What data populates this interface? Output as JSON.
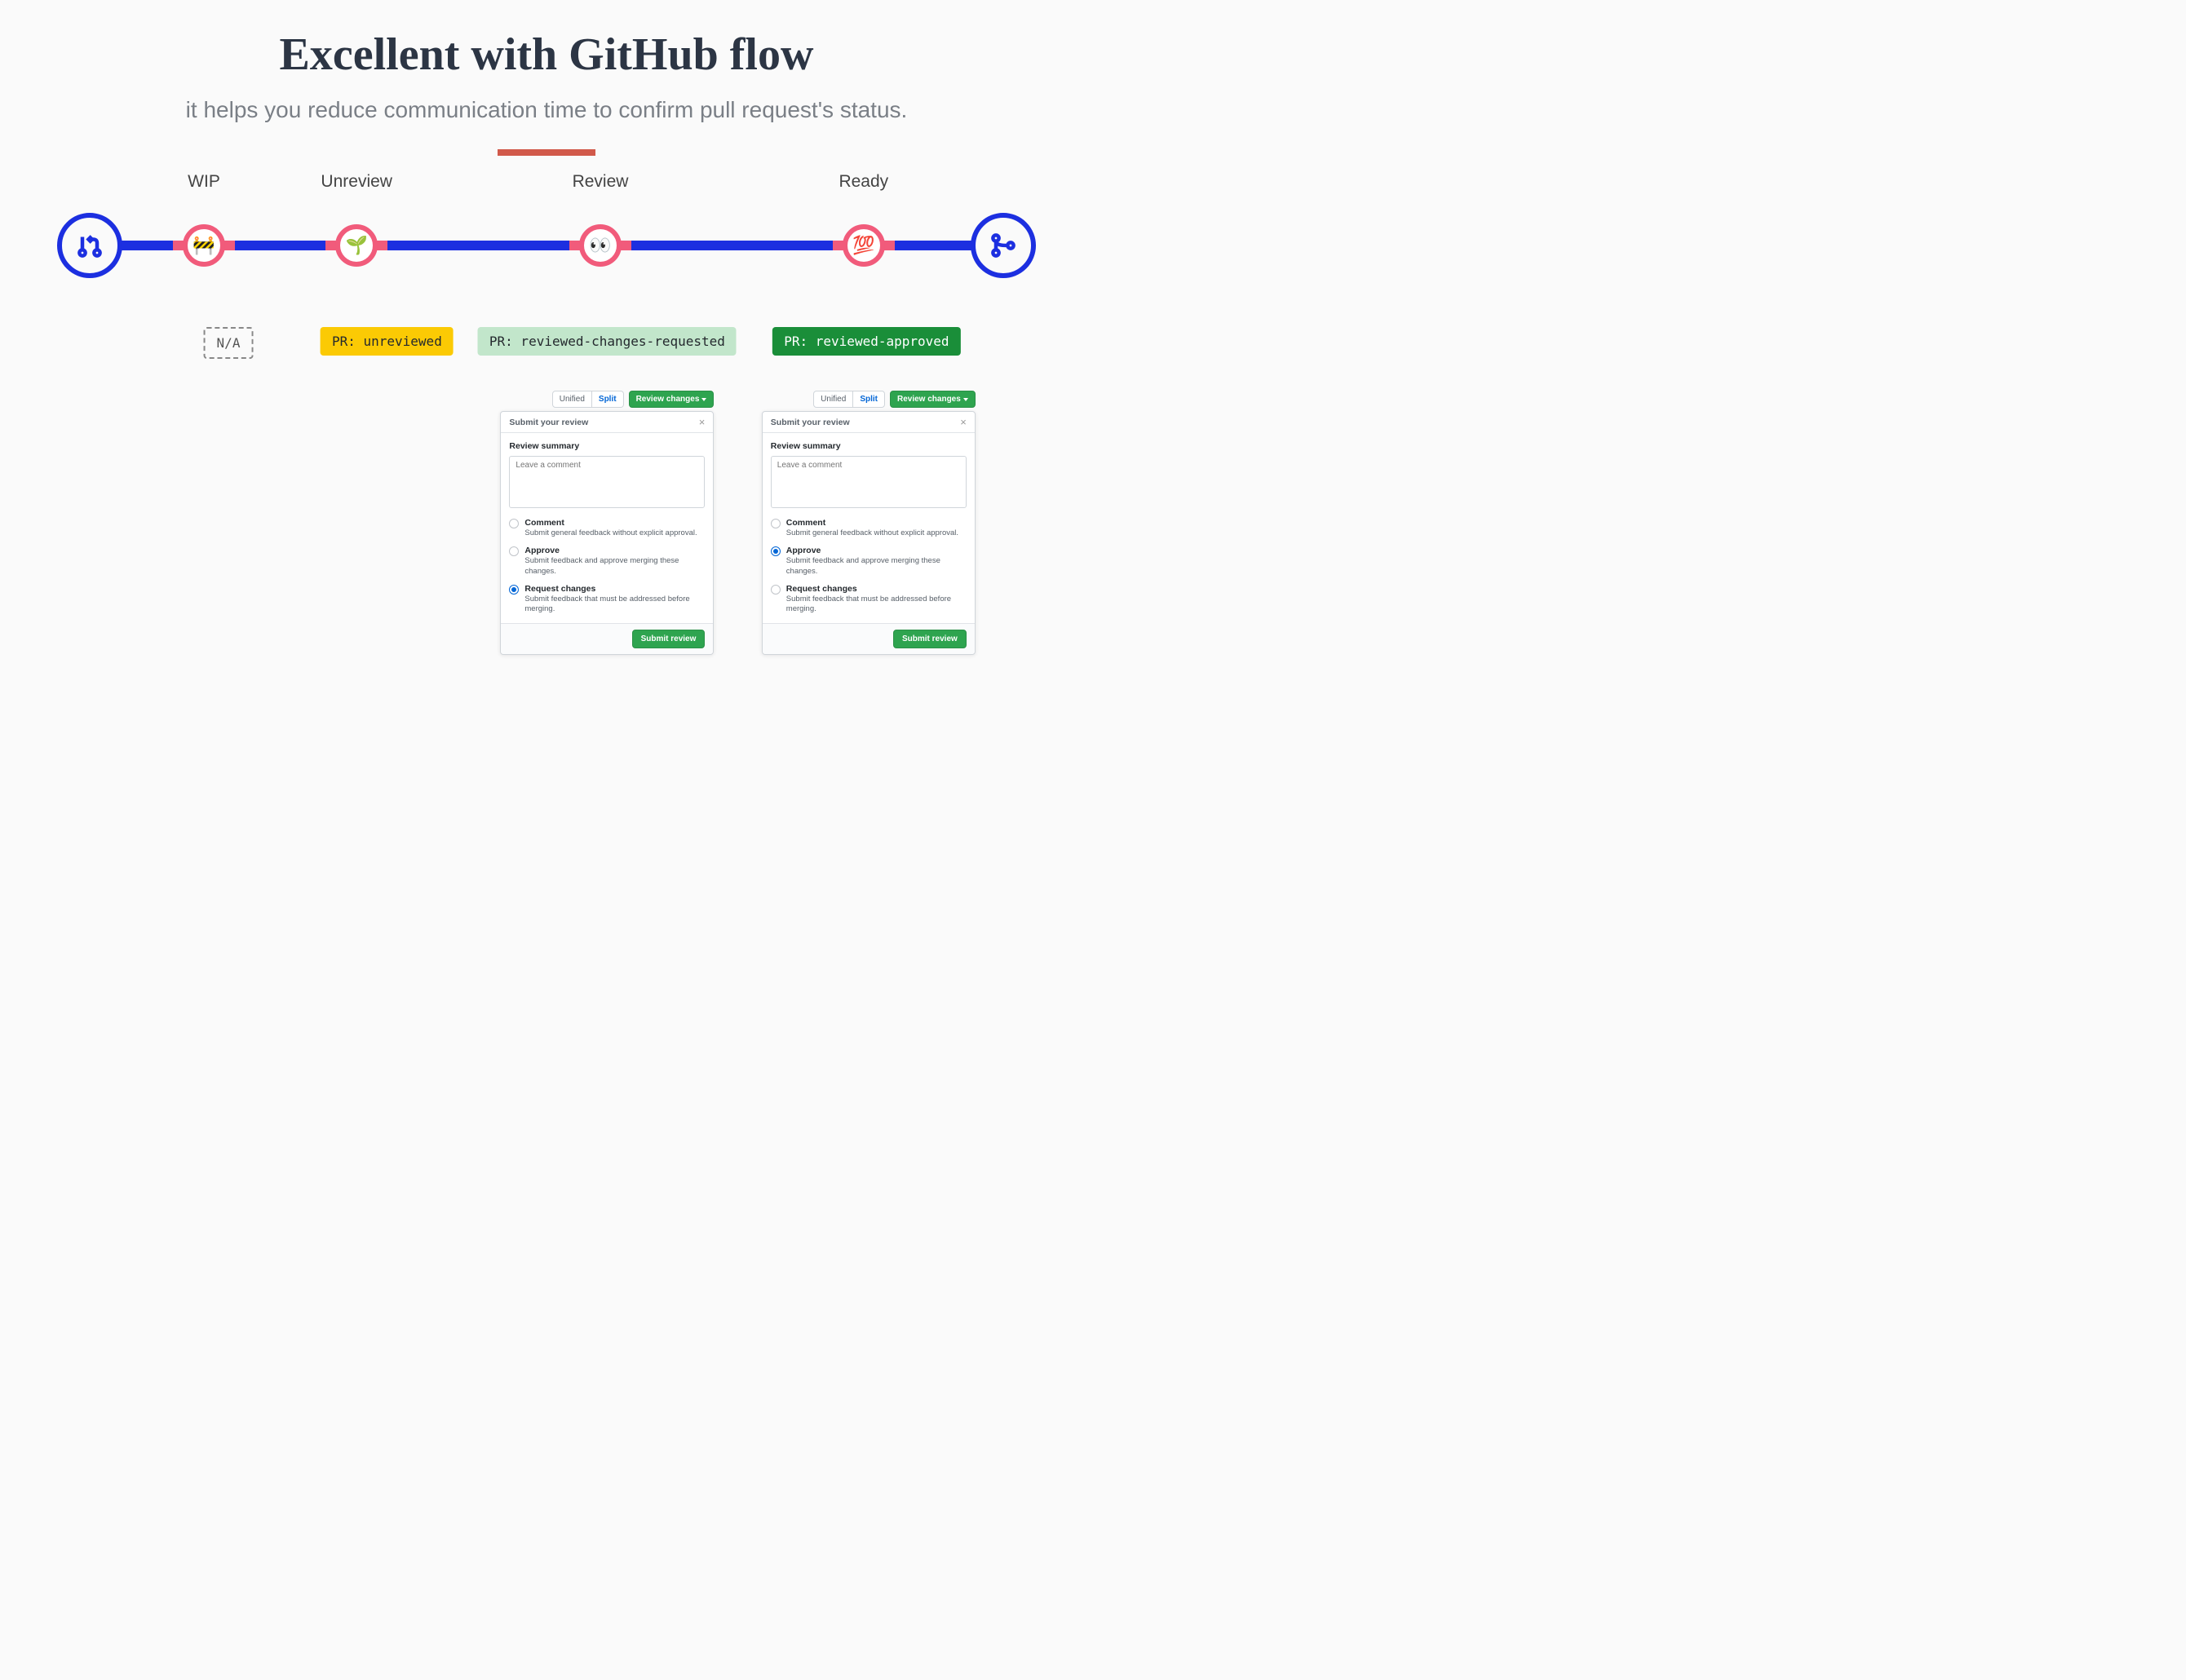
{
  "header": {
    "title": "Excellent with GitHub flow",
    "subtitle": "it helps you reduce communication time to confirm pull request's status."
  },
  "colors": {
    "accent_blue": "#1c2fe0",
    "accent_pink": "#f15b7b",
    "divider_red": "#d1594a",
    "badge_yellow": "#fbca04",
    "badge_mint": "#c2e6cb",
    "badge_green": "#1a8e39"
  },
  "flow": {
    "stages": [
      {
        "label": "WIP",
        "emoji": "🚧",
        "x_pct": 15.0
      },
      {
        "label": "Unreview",
        "emoji": "🌱",
        "x_pct": 30.6
      },
      {
        "label": "Review",
        "emoji": "👀",
        "x_pct": 55.5
      },
      {
        "label": "Ready",
        "emoji": "💯",
        "x_pct": 82.4
      }
    ],
    "start_icon": "pull-request-icon",
    "end_icon": "merge-icon"
  },
  "badges": [
    {
      "text": "N/A",
      "style": "na",
      "x_pct": 17.5
    },
    {
      "text": "PR: unreviewed",
      "style": "yellow",
      "x_pct": 33.7
    },
    {
      "text": "PR: reviewed-changes-requested",
      "style": "mint",
      "x_pct": 56.2
    },
    {
      "text": "PR: reviewed-approved",
      "style": "green",
      "x_pct": 82.7
    }
  ],
  "review_panel": {
    "toolbar": {
      "unified": "Unified",
      "split": "Split",
      "review_changes": "Review changes"
    },
    "header": "Submit your review",
    "summary_label": "Review summary",
    "comment_placeholder": "Leave a comment",
    "options": [
      {
        "key": "comment",
        "label": "Comment",
        "desc": "Submit general feedback without explicit approval."
      },
      {
        "key": "approve",
        "label": "Approve",
        "desc": "Submit feedback and approve merging these changes."
      },
      {
        "key": "request",
        "label": "Request changes",
        "desc": "Submit feedback that must be addressed before merging."
      }
    ],
    "submit": "Submit review"
  },
  "panels": [
    {
      "stage": "Review",
      "selected_option": "request",
      "x_pct": 56.2
    },
    {
      "stage": "Ready",
      "selected_option": "approve",
      "x_pct": 82.9
    }
  ]
}
